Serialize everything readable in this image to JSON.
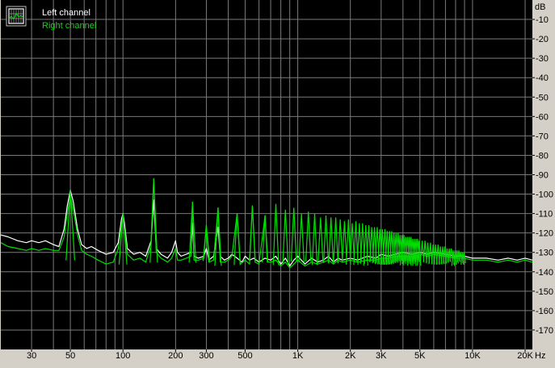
{
  "window_bg": "#d4d0c8",
  "colors": {
    "plot_bg": "#000000",
    "grid": "#7a7a7a",
    "axis_text": "#000000",
    "left_channel": "#ffffff",
    "right_channel": "#00e000",
    "legend_icon": "grid-chart-icon"
  },
  "chart_data": {
    "type": "line",
    "x_scale": "log",
    "xlim": [
      20,
      22000
    ],
    "ylim": [
      -180,
      0
    ],
    "grid": true,
    "legend_position": "top-left",
    "xunit": "Hz",
    "yunit": "dB",
    "x_tick_labels": [
      {
        "v": 30,
        "label": "30"
      },
      {
        "v": 50,
        "label": "50"
      },
      {
        "v": 100,
        "label": "100"
      },
      {
        "v": 200,
        "label": "200"
      },
      {
        "v": 300,
        "label": "300"
      },
      {
        "v": 500,
        "label": "500"
      },
      {
        "v": 1000,
        "label": "1K"
      },
      {
        "v": 2000,
        "label": "2K"
      },
      {
        "v": 3000,
        "label": "3K"
      },
      {
        "v": 5000,
        "label": "5K"
      },
      {
        "v": 10000,
        "label": "10K"
      },
      {
        "v": 20000,
        "label": "20K"
      }
    ],
    "x_grid": [
      30,
      40,
      50,
      60,
      70,
      80,
      90,
      100,
      200,
      300,
      400,
      500,
      600,
      700,
      800,
      900,
      1000,
      2000,
      3000,
      4000,
      5000,
      6000,
      7000,
      8000,
      9000,
      10000,
      20000
    ],
    "y_ticks": [
      -10,
      -20,
      -30,
      -40,
      -50,
      -60,
      -70,
      -80,
      -90,
      -100,
      -110,
      -120,
      -130,
      -140,
      -150,
      -160,
      -170
    ],
    "y_tick_labels": [
      "-10",
      "-20",
      "-30",
      "-40",
      "-50",
      "-60",
      "-70",
      "-80",
      "-90",
      "-100",
      "-110",
      "-120",
      "-130",
      "-140",
      "-150",
      "-160",
      "-170"
    ],
    "series": [
      {
        "name": "Left channel",
        "color": "#ffffff",
        "points": [
          [
            20,
            -121
          ],
          [
            22,
            -122
          ],
          [
            25,
            -124
          ],
          [
            28,
            -125
          ],
          [
            30,
            -124
          ],
          [
            33,
            -125
          ],
          [
            36,
            -124
          ],
          [
            40,
            -126
          ],
          [
            43,
            -127
          ],
          [
            46,
            -118
          ],
          [
            48,
            -106
          ],
          [
            50,
            -98
          ],
          [
            52,
            -104
          ],
          [
            55,
            -118
          ],
          [
            58,
            -126
          ],
          [
            62,
            -128
          ],
          [
            66,
            -127
          ],
          [
            72,
            -129
          ],
          [
            80,
            -131
          ],
          [
            88,
            -130
          ],
          [
            94,
            -125
          ],
          [
            98,
            -113
          ],
          [
            100,
            -110
          ],
          [
            102,
            -115
          ],
          [
            106,
            -128
          ],
          [
            115,
            -131
          ],
          [
            125,
            -130
          ],
          [
            135,
            -132
          ],
          [
            145,
            -124
          ],
          [
            150,
            -103
          ],
          [
            155,
            -128
          ],
          [
            165,
            -131
          ],
          [
            180,
            -133
          ],
          [
            190,
            -130
          ],
          [
            200,
            -124
          ],
          [
            205,
            -130
          ],
          [
            215,
            -132
          ],
          [
            230,
            -131
          ],
          [
            245,
            -130
          ],
          [
            250,
            -115
          ],
          [
            255,
            -132
          ],
          [
            270,
            -133
          ],
          [
            290,
            -132
          ],
          [
            300,
            -128
          ],
          [
            310,
            -134
          ],
          [
            330,
            -132
          ],
          [
            350,
            -117
          ],
          [
            360,
            -132
          ],
          [
            380,
            -134
          ],
          [
            400,
            -133
          ],
          [
            420,
            -131
          ],
          [
            450,
            -133
          ],
          [
            480,
            -135
          ],
          [
            500,
            -132
          ],
          [
            530,
            -134
          ],
          [
            560,
            -133
          ],
          [
            600,
            -135
          ],
          [
            650,
            -133
          ],
          [
            700,
            -134
          ],
          [
            750,
            -132
          ],
          [
            800,
            -136
          ],
          [
            850,
            -133
          ],
          [
            900,
            -137
          ],
          [
            950,
            -134
          ],
          [
            1000,
            -132
          ],
          [
            1100,
            -136
          ],
          [
            1200,
            -133
          ],
          [
            1300,
            -135
          ],
          [
            1400,
            -134
          ],
          [
            1500,
            -132
          ],
          [
            1600,
            -135
          ],
          [
            1700,
            -133
          ],
          [
            1800,
            -134
          ],
          [
            2000,
            -133
          ],
          [
            2200,
            -134
          ],
          [
            2500,
            -132
          ],
          [
            2800,
            -133
          ],
          [
            3000,
            -131
          ],
          [
            3300,
            -132
          ],
          [
            3600,
            -131
          ],
          [
            4000,
            -130
          ],
          [
            4500,
            -131
          ],
          [
            5000,
            -130
          ],
          [
            5500,
            -131
          ],
          [
            6000,
            -130
          ],
          [
            7000,
            -131
          ],
          [
            8000,
            -132
          ],
          [
            9000,
            -132
          ],
          [
            10000,
            -133
          ],
          [
            12000,
            -133
          ],
          [
            14000,
            -134
          ],
          [
            16000,
            -133
          ],
          [
            18000,
            -134
          ],
          [
            20000,
            -133
          ],
          [
            22000,
            -134
          ]
        ]
      },
      {
        "name": "Right channel",
        "color": "#00e000",
        "points": [
          [
            20,
            -125
          ],
          [
            22,
            -127
          ],
          [
            25,
            -128
          ],
          [
            28,
            -129
          ],
          [
            30,
            -128
          ],
          [
            33,
            -129
          ],
          [
            36,
            -128
          ],
          [
            40,
            -129
          ],
          [
            43,
            -129
          ],
          [
            46,
            -122
          ],
          [
            48,
            -110
          ],
          [
            50,
            -101
          ],
          [
            52,
            -108
          ],
          [
            55,
            -121
          ],
          [
            58,
            -129
          ],
          [
            62,
            -131
          ],
          [
            66,
            -132
          ],
          [
            72,
            -134
          ],
          [
            80,
            -136
          ],
          [
            88,
            -135
          ],
          [
            94,
            -128
          ],
          [
            98,
            -116
          ],
          [
            100,
            -112
          ],
          [
            102,
            -118
          ],
          [
            106,
            -131
          ],
          [
            115,
            -134
          ],
          [
            125,
            -133
          ],
          [
            135,
            -135
          ],
          [
            145,
            -126
          ],
          [
            150,
            -92
          ],
          [
            155,
            -130
          ],
          [
            165,
            -133
          ],
          [
            180,
            -135
          ],
          [
            190,
            -133
          ],
          [
            200,
            -128
          ],
          [
            205,
            -134
          ],
          [
            215,
            -134
          ],
          [
            230,
            -133
          ],
          [
            245,
            -132
          ],
          [
            250,
            -104
          ],
          [
            255,
            -134
          ],
          [
            270,
            -134
          ],
          [
            290,
            -133
          ],
          [
            300,
            -116
          ],
          [
            310,
            -135
          ],
          [
            330,
            -134
          ],
          [
            350,
            -107
          ],
          [
            360,
            -135
          ],
          [
            380,
            -135
          ],
          [
            400,
            -134
          ],
          [
            420,
            -132
          ],
          [
            450,
            -110
          ],
          [
            470,
            -136
          ],
          [
            500,
            -134
          ],
          [
            530,
            -136
          ],
          [
            550,
            -106
          ],
          [
            570,
            -135
          ],
          [
            600,
            -136
          ],
          [
            650,
            -111
          ],
          [
            670,
            -135
          ],
          [
            700,
            -135
          ],
          [
            750,
            -134
          ],
          [
            800,
            -137
          ],
          [
            850,
            -135
          ],
          [
            900,
            -138
          ],
          [
            950,
            -136
          ],
          [
            1000,
            -134
          ],
          [
            1100,
            -137
          ],
          [
            1200,
            -135
          ],
          [
            1300,
            -136
          ],
          [
            1400,
            -135
          ],
          [
            1500,
            -134
          ],
          [
            1600,
            -136
          ],
          [
            1700,
            -134
          ],
          [
            1800,
            -135
          ],
          [
            2000,
            -134
          ],
          [
            2200,
            -135
          ],
          [
            2500,
            -134
          ],
          [
            2800,
            -134
          ],
          [
            3000,
            -133
          ],
          [
            3300,
            -133
          ],
          [
            3600,
            -132
          ],
          [
            4000,
            -132
          ],
          [
            4500,
            -132
          ],
          [
            5000,
            -131
          ],
          [
            5500,
            -132
          ],
          [
            6000,
            -131
          ],
          [
            7000,
            -132
          ],
          [
            8000,
            -133
          ],
          [
            9000,
            -133
          ],
          [
            10000,
            -134
          ],
          [
            12000,
            -134
          ],
          [
            14000,
            -135
          ],
          [
            16000,
            -134
          ],
          [
            18000,
            -135
          ],
          [
            20000,
            -134
          ],
          [
            22000,
            -135
          ]
        ],
        "harmonic_peaks": [
          [
            50,
            -98
          ],
          [
            100,
            -110
          ],
          [
            150,
            -92
          ],
          [
            250,
            -104
          ],
          [
            300,
            -116
          ],
          [
            350,
            -107
          ],
          [
            450,
            -110
          ],
          [
            550,
            -106
          ],
          [
            650,
            -111
          ],
          [
            750,
            -105
          ],
          [
            850,
            -108
          ],
          [
            950,
            -107
          ],
          [
            1050,
            -110
          ],
          [
            1150,
            -109
          ],
          [
            1250,
            -110
          ],
          [
            1350,
            -112
          ],
          [
            1450,
            -111
          ],
          [
            1550,
            -112
          ],
          [
            1650,
            -112
          ],
          [
            1750,
            -113
          ],
          [
            1850,
            -114
          ],
          [
            1950,
            -113
          ],
          [
            2050,
            -115
          ],
          [
            2150,
            -114
          ],
          [
            2250,
            -115
          ],
          [
            2350,
            -115
          ],
          [
            2450,
            -116
          ],
          [
            2550,
            -116
          ],
          [
            2650,
            -117
          ],
          [
            2750,
            -117
          ],
          [
            2850,
            -117
          ],
          [
            2950,
            -118
          ],
          [
            3050,
            -118
          ],
          [
            3150,
            -118
          ],
          [
            3250,
            -119
          ],
          [
            3350,
            -119
          ],
          [
            3450,
            -119
          ],
          [
            3550,
            -120
          ],
          [
            3650,
            -120
          ],
          [
            3750,
            -120
          ],
          [
            3850,
            -121
          ],
          [
            3950,
            -121
          ],
          [
            4050,
            -121
          ],
          [
            4150,
            -122
          ],
          [
            4250,
            -122
          ],
          [
            4350,
            -122
          ],
          [
            4450,
            -122
          ],
          [
            4550,
            -123
          ],
          [
            4650,
            -123
          ],
          [
            4750,
            -123
          ],
          [
            4850,
            -123
          ],
          [
            4950,
            -124
          ],
          [
            5150,
            -124
          ],
          [
            5350,
            -124
          ],
          [
            5550,
            -125
          ],
          [
            5750,
            -125
          ],
          [
            5950,
            -126
          ],
          [
            6150,
            -126
          ],
          [
            6350,
            -126
          ],
          [
            6550,
            -127
          ],
          [
            6750,
            -127
          ],
          [
            6950,
            -127
          ],
          [
            7150,
            -128
          ],
          [
            7350,
            -128
          ],
          [
            7550,
            -128
          ],
          [
            7750,
            -129
          ],
          [
            7950,
            -129
          ],
          [
            8150,
            -129
          ],
          [
            8350,
            -129
          ],
          [
            8550,
            -130
          ],
          [
            8750,
            -130
          ],
          [
            8950,
            -130
          ]
        ]
      }
    ]
  },
  "axis": {
    "y_unit_label": "dB",
    "x_unit_label": "Hz"
  },
  "legend": {
    "left_label": "Left channel",
    "right_label": "Right channel"
  }
}
